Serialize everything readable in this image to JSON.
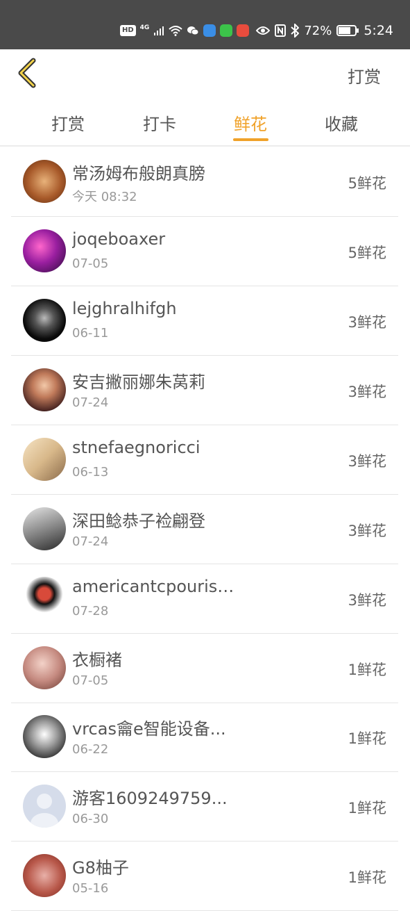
{
  "status_bar": {
    "hd": "HD",
    "network": "4G",
    "battery": "72%",
    "time": "5:24",
    "left_icons": [
      "signal-icon",
      "wifi-icon",
      "wechat-icon",
      "app-icon",
      "line-icon",
      "app-icon"
    ],
    "right_icons": [
      "eye-icon",
      "nfc-icon",
      "bluetooth-icon",
      "battery-icon"
    ]
  },
  "header": {
    "back_icon": "chevron-left-icon",
    "action_label": "打赏"
  },
  "tabs": [
    {
      "label": "打赏",
      "active": false
    },
    {
      "label": "打卡",
      "active": false
    },
    {
      "label": "鲜花",
      "active": true
    },
    {
      "label": "收藏",
      "active": false
    }
  ],
  "accent_color": "#f0a22a",
  "list": [
    {
      "name": "常汤姆布般朗真膀",
      "date": "今天 08:32",
      "count": "5鲜花"
    },
    {
      "name": "joqeboaxer",
      "date": "07-05",
      "count": "5鲜花"
    },
    {
      "name": "lejghralhifgh",
      "date": "06-11",
      "count": "3鲜花"
    },
    {
      "name": "安吉撇丽娜朱莴莉",
      "date": "07-24",
      "count": "3鲜花"
    },
    {
      "name": "stnefaegnoricci",
      "date": "06-13",
      "count": "3鲜花"
    },
    {
      "name": "深田鲶恭子裣翩登",
      "date": "07-24",
      "count": "3鲜花"
    },
    {
      "name": "americantcpourist...",
      "date": "07-28",
      "count": "3鲜花"
    },
    {
      "name": "衣橱褚",
      "date": "07-05",
      "count": "1鲜花"
    },
    {
      "name": "vrcas龠e智能设备...",
      "date": "06-22",
      "count": "1鲜花"
    },
    {
      "name": "游客1609249759...",
      "date": "06-30",
      "count": "1鲜花"
    },
    {
      "name": "G8柚子",
      "date": "05-16",
      "count": "1鲜花"
    }
  ]
}
